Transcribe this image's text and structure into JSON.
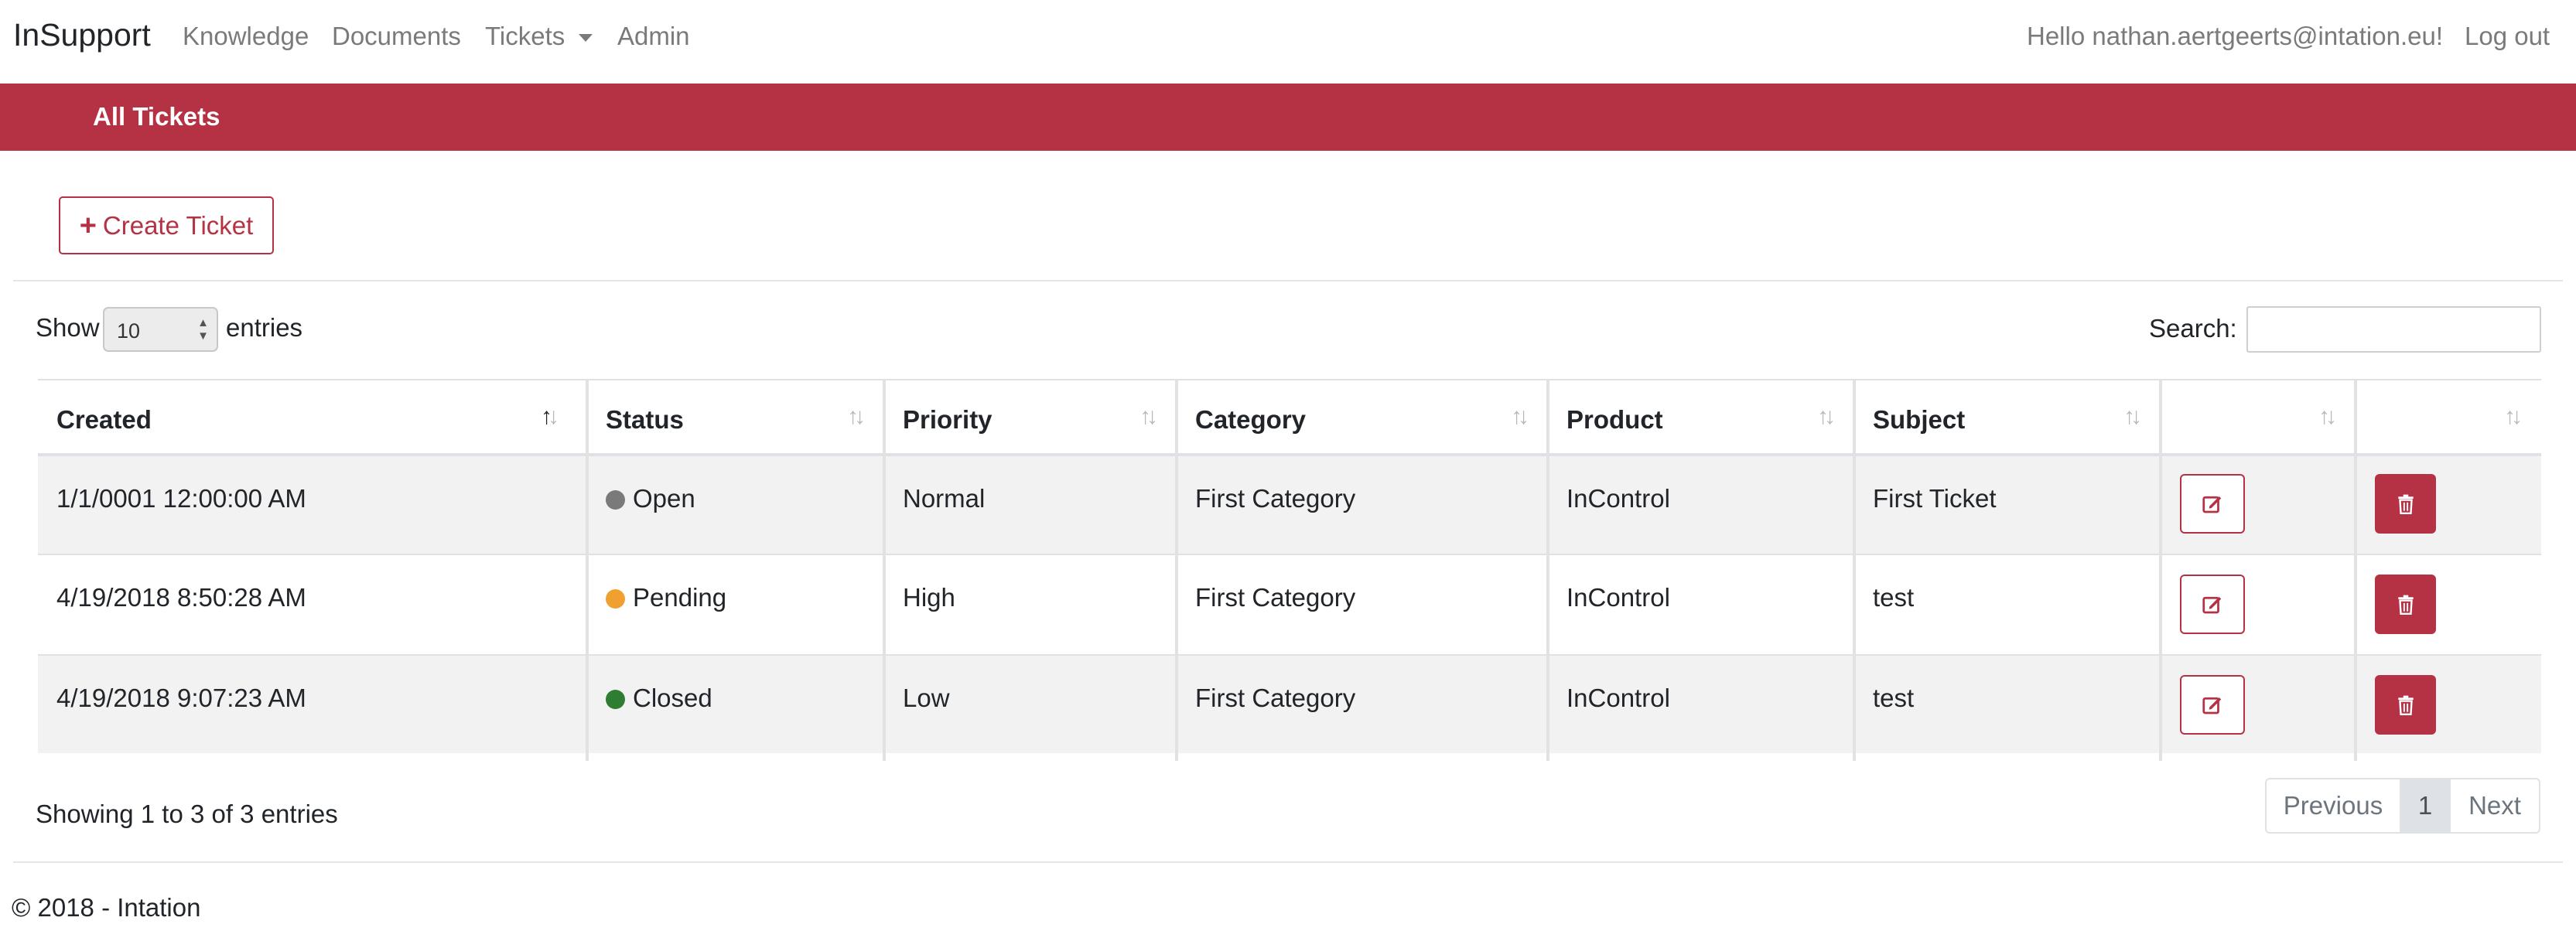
{
  "nav": {
    "brand": "InSupport",
    "links": [
      "Knowledge",
      "Documents",
      "Tickets",
      "Admin"
    ],
    "greeting": "Hello nathan.aertgeerts@intation.eu!",
    "logout": "Log out"
  },
  "band": {
    "title": "All Tickets"
  },
  "toolbar": {
    "create_label": "Create Ticket",
    "create_icon": "plus-icon"
  },
  "length": {
    "show_label": "Show",
    "value": "10",
    "entries_label": "entries"
  },
  "search": {
    "label": "Search:",
    "value": ""
  },
  "table": {
    "columns": [
      "Created",
      "Status",
      "Priority",
      "Category",
      "Product",
      "Subject",
      "",
      ""
    ],
    "sorted_column": "Created",
    "rows": [
      {
        "created": "1/1/0001 12:00:00 AM",
        "status": "Open",
        "status_color": "#7a7a7a",
        "priority": "Normal",
        "category": "First Category",
        "product": "InControl",
        "subject": "First Ticket"
      },
      {
        "created": "4/19/2018 8:50:28 AM",
        "status": "Pending",
        "status_color": "#f0a030",
        "priority": "High",
        "category": "First Category",
        "product": "InControl",
        "subject": "test"
      },
      {
        "created": "4/19/2018 9:07:23 AM",
        "status": "Closed",
        "status_color": "#2e7d32",
        "priority": "Low",
        "category": "First Category",
        "product": "InControl",
        "subject": "test"
      }
    ],
    "row_actions": {
      "edit_icon": "edit-icon",
      "delete_icon": "trash-icon"
    }
  },
  "info": "Showing 1 to 3 of 3 entries",
  "pagination": {
    "previous": "Previous",
    "current": "1",
    "next": "Next"
  },
  "footer": {
    "copyright": "© 2018 - Intation"
  },
  "colors": {
    "accent": "#b53244",
    "nav_text": "#7a7a7a"
  }
}
